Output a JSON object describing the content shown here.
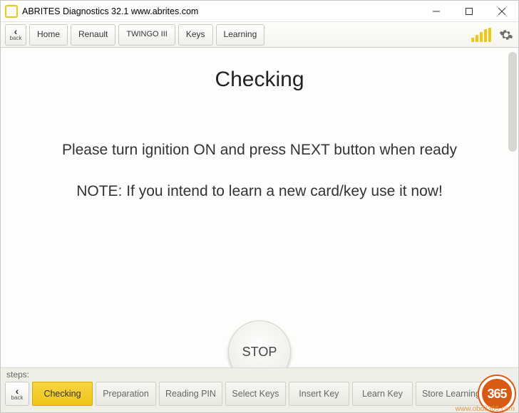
{
  "window": {
    "title": "ABRITES Diagnostics 32.1   www.abrites.com"
  },
  "toolbar": {
    "back_label": "back",
    "crumbs": {
      "home": "Home",
      "renault": "Renault",
      "twingo": "TWINGO III",
      "keys": "Keys",
      "learning": "Learning"
    }
  },
  "content": {
    "heading": "Checking",
    "message": "Please turn ignition ON and press NEXT button when ready",
    "note": "NOTE: If you intend to learn a new card/key use it now!",
    "stop_label": "STOP"
  },
  "steps": {
    "label": "steps:",
    "back_label": "back",
    "items": {
      "checking": "Checking",
      "preparation": "Preparation",
      "reading_pin": "Reading PIN",
      "select_keys": "Select Keys",
      "insert_key": "Insert Key",
      "learn_key": "Learn Key",
      "store": "Store Learning"
    }
  },
  "watermark": {
    "digits": "365",
    "url": "www.obdii365.com"
  }
}
